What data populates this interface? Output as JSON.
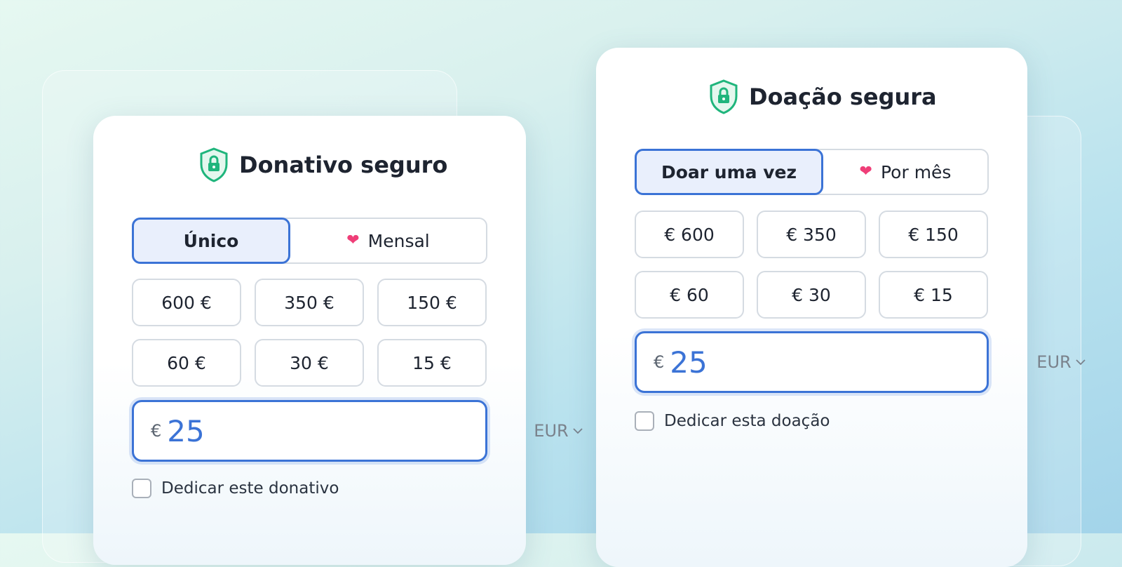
{
  "left_card": {
    "title": "Donativo seguro",
    "toggle": {
      "once": "Único",
      "monthly": "Mensal",
      "selected": "Único"
    },
    "amounts": [
      "600 €",
      "350 €",
      "150 €",
      "60 €",
      "30 €",
      "15 €"
    ],
    "custom": {
      "currency_symbol": "€",
      "value": "25",
      "currency": "EUR"
    },
    "dedicate_label": "Dedicar este donativo",
    "dedicate_checked": false
  },
  "right_card": {
    "title": "Doação segura",
    "toggle": {
      "once": "Doar uma vez",
      "monthly": "Por mês",
      "selected": "Doar uma vez"
    },
    "amounts": [
      "€ 600",
      "€ 350",
      "€ 150",
      "€ 60",
      "€ 30",
      "€ 15"
    ],
    "custom": {
      "currency_symbol": "€",
      "value": "25",
      "currency": "EUR"
    },
    "dedicate_label": "Dedicar esta doação",
    "dedicate_checked": false
  },
  "colors": {
    "accent": "#3b73d6",
    "selected_bg": "#e9effc",
    "shield": "#1fb57c",
    "heart": "#ef3e78",
    "text": "#1e2430"
  },
  "icons": [
    "shield-lock-icon",
    "heart-icon",
    "chevron-down-icon",
    "checkbox-icon"
  ]
}
